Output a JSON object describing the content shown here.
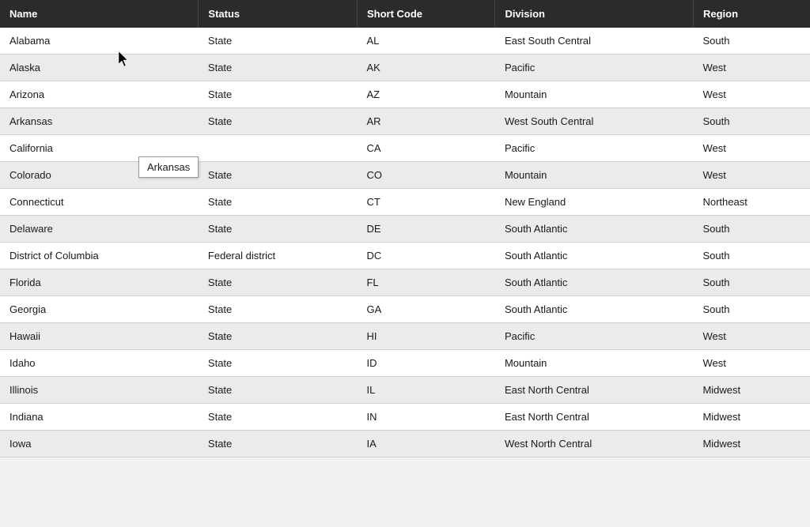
{
  "table": {
    "columns": [
      {
        "key": "name",
        "label": "Name"
      },
      {
        "key": "status",
        "label": "Status"
      },
      {
        "key": "short_code",
        "label": "Short Code"
      },
      {
        "key": "division",
        "label": "Division"
      },
      {
        "key": "region",
        "label": "Region"
      }
    ],
    "rows": [
      {
        "name": "Alabama",
        "status": "State",
        "short_code": "AL",
        "division": "East South Central",
        "region": "South"
      },
      {
        "name": "Alaska",
        "status": "State",
        "short_code": "AK",
        "division": "Pacific",
        "region": "West"
      },
      {
        "name": "Arizona",
        "status": "State",
        "short_code": "AZ",
        "division": "Mountain",
        "region": "West"
      },
      {
        "name": "Arkansas",
        "status": "State",
        "short_code": "AR",
        "division": "West South Central",
        "region": "South"
      },
      {
        "name": "California",
        "status": "",
        "short_code": "CA",
        "division": "Pacific",
        "region": "West"
      },
      {
        "name": "Colorado",
        "status": "State",
        "short_code": "CO",
        "division": "Mountain",
        "region": "West"
      },
      {
        "name": "Connecticut",
        "status": "State",
        "short_code": "CT",
        "division": "New England",
        "region": "Northeast"
      },
      {
        "name": "Delaware",
        "status": "State",
        "short_code": "DE",
        "division": "South Atlantic",
        "region": "South"
      },
      {
        "name": "District of Columbia",
        "status": "Federal district",
        "short_code": "DC",
        "division": "South Atlantic",
        "region": "South"
      },
      {
        "name": "Florida",
        "status": "State",
        "short_code": "FL",
        "division": "South Atlantic",
        "region": "South"
      },
      {
        "name": "Georgia",
        "status": "State",
        "short_code": "GA",
        "division": "South Atlantic",
        "region": "South"
      },
      {
        "name": "Hawaii",
        "status": "State",
        "short_code": "HI",
        "division": "Pacific",
        "region": "West"
      },
      {
        "name": "Idaho",
        "status": "State",
        "short_code": "ID",
        "division": "Mountain",
        "region": "West"
      },
      {
        "name": "Illinois",
        "status": "State",
        "short_code": "IL",
        "division": "East North Central",
        "region": "Midwest"
      },
      {
        "name": "Indiana",
        "status": "State",
        "short_code": "IN",
        "division": "East North Central",
        "region": "Midwest"
      },
      {
        "name": "Iowa",
        "status": "State",
        "short_code": "IA",
        "division": "West North Central",
        "region": "Midwest"
      }
    ],
    "tooltip": {
      "text": "Arkansas",
      "visible": true
    }
  }
}
